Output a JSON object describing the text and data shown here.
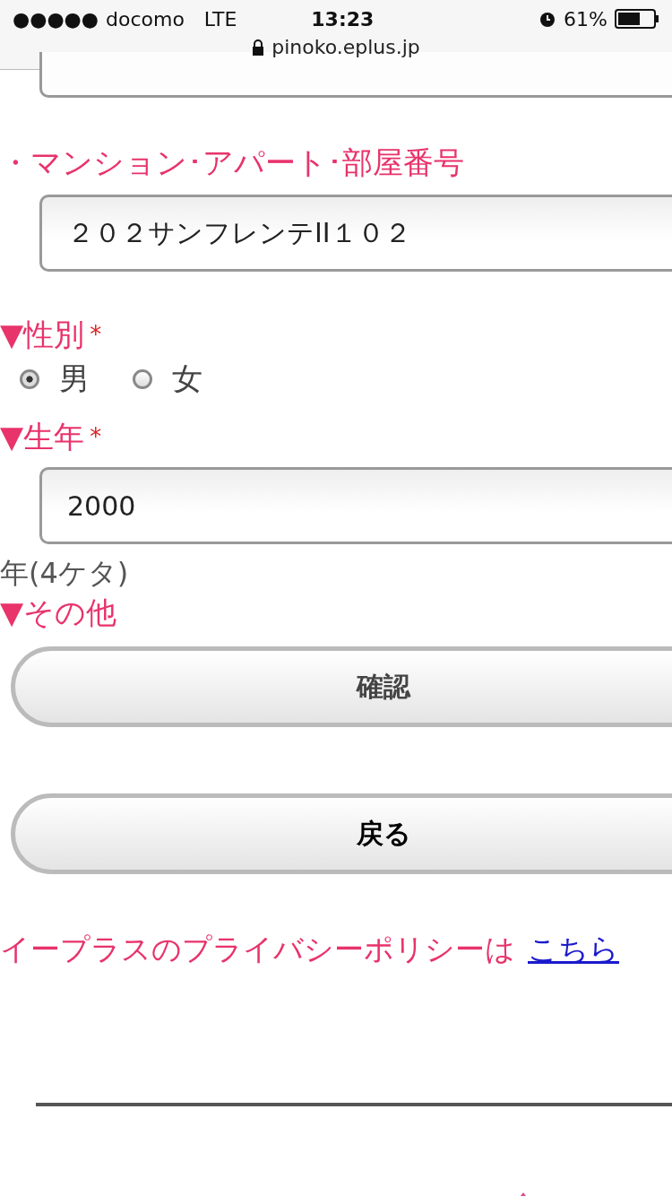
{
  "status_bar": {
    "signal": "●●●●●",
    "carrier": "docomo",
    "network": "LTE",
    "time": "13:23",
    "battery": "61%"
  },
  "url_bar": {
    "url": "pinoko.eplus.jp"
  },
  "form": {
    "building_label": "・マンション･アパート･部屋番号",
    "building_value": "２０２サンフレンテII１０２",
    "gender": {
      "marker": "▼",
      "label": "性別",
      "required": "*",
      "options": [
        {
          "label": "男",
          "selected": true
        },
        {
          "label": "女",
          "selected": false
        }
      ]
    },
    "birth_year": {
      "marker": "▼",
      "label": "生年",
      "required": "*",
      "value": "2000",
      "hint": "年(4ケタ)"
    },
    "other": {
      "marker": "▼",
      "label": "その他"
    },
    "buttons": [
      {
        "label": "確認",
        "kind": "confirm"
      },
      {
        "label": "戻る",
        "kind": "back"
      }
    ]
  },
  "privacy": {
    "text": "イープラスのプライバシーポリシーは",
    "link": "こちら"
  }
}
